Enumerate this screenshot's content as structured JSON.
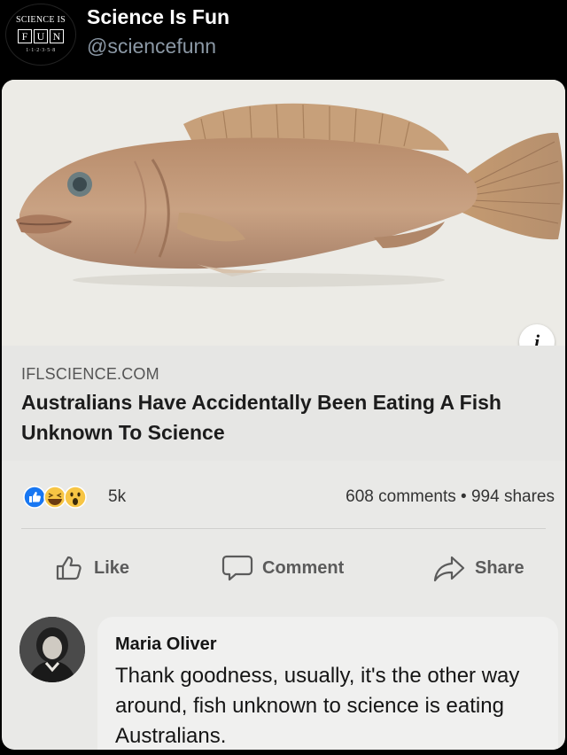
{
  "account": {
    "display_name": "Science Is Fun",
    "handle": "@sciencefunn",
    "logo_line1": "SCIENCE IS",
    "logo_letters": [
      "F",
      "U",
      "N"
    ],
    "logo_line3": "1·1·2·3·5·8"
  },
  "post": {
    "image_icon": "fish-photo",
    "info_label": "i",
    "source": "IFLSCIENCE.COM",
    "headline": "Australians Have Accidentally Been Eating A Fish Unknown To Science",
    "reaction_icons": [
      "like-icon",
      "haha-icon",
      "wow-icon"
    ],
    "reaction_count": "5k",
    "comments_shares": "608 comments • 994 shares"
  },
  "actions": {
    "like_label": "Like",
    "comment_label": "Comment",
    "share_label": "Share"
  },
  "comment": {
    "author": "Maria Oliver",
    "text": "Thank goodness, usually, it's the other way around, fish unknown to science is eating Australians."
  },
  "colors": {
    "background": "#000000",
    "card": "#e9e9e7",
    "like_blue": "#1877f2",
    "handle_gray": "#8b98a5"
  }
}
